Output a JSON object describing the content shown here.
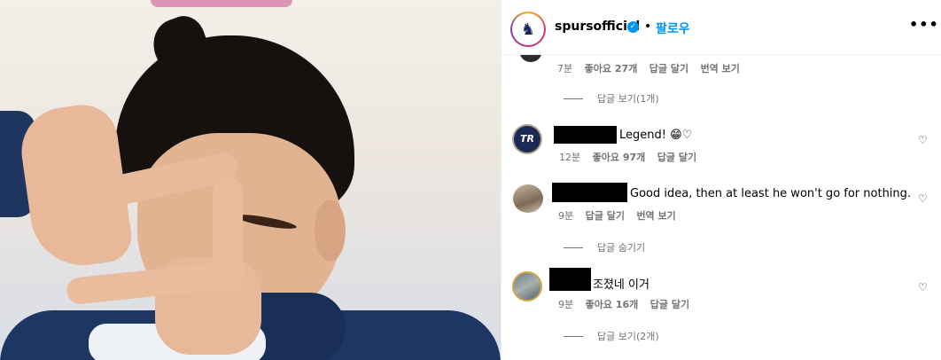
{
  "post": {
    "username": "spursofficial",
    "dot": "•",
    "follow_label": "팔로우",
    "more_label": "•••"
  },
  "comments": [
    {
      "time": "7분",
      "likes": "좋아요 27개",
      "reply": "답글 달기",
      "translate": "번역 보기",
      "view_replies": "답글 보기(1개)"
    },
    {
      "text": "Legend! 😁♡",
      "time": "12분",
      "likes": "좋아요 97개",
      "reply": "답글 달기"
    },
    {
      "text": "Good idea, then at least he won't go for nothing.",
      "time": "9분",
      "reply": "답글 달기",
      "translate": "번역 보기",
      "hide_replies": "답글 숨기기"
    },
    {
      "text": "조졌네 이거",
      "time": "9분",
      "likes": "좋아요 16개",
      "reply": "답글 달기",
      "view_replies": "답글 보기(2개)"
    }
  ]
}
